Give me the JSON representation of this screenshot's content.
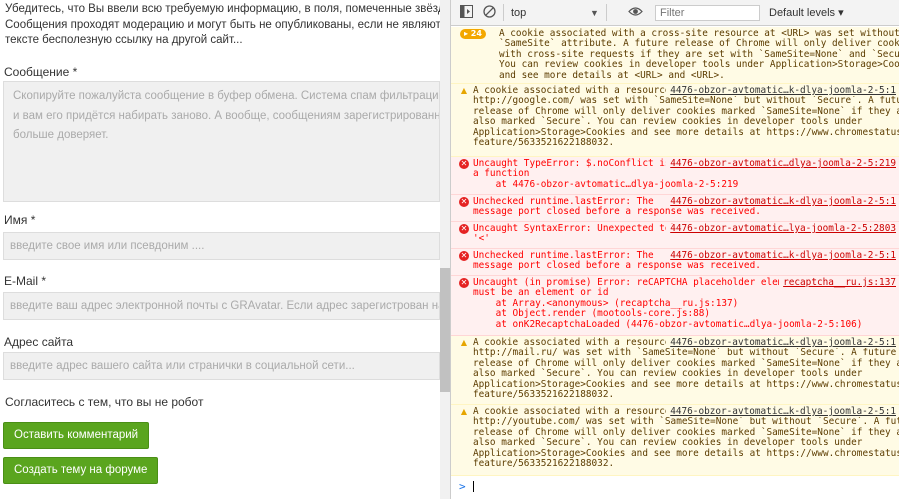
{
  "page": {
    "intro_lines": [
      "Убедитесь, что Вы ввели всю требуемую информацию, в поля, помеченные звёздочкой",
      "Сообщения проходят модерацию и могут быть не опубликованы, если не являются осмы",
      "тексте бесполезную ссылку на другой сайт..."
    ],
    "message_label": "Сообщение *",
    "message_placeholder_lines": [
      "Скопируйте пожалуйста сообщение в буфер обмена. Система спам фильтрации может з",
      "и вам его придётся набирать заново. А вообще, сообщениям зарегистрированных польз",
      "больше доверяет."
    ],
    "name_label": "Имя *",
    "name_placeholder": "введите свое имя или псевдоним ....",
    "email_label": "E-Mail *",
    "email_placeholder": "введите ваш адрес электронной почты с GRAvatar. Если адрес зарегистрован на сайте - в",
    "site_label": "Адрес сайта",
    "site_placeholder": "введите адрес вашего сайта или странички в социальной сети...",
    "captcha_text": "Согласитесь с тем, что вы не робот",
    "submit_button": "Оставить комментарий",
    "forum_button": "Создать тему на форуме"
  },
  "devtools": {
    "context": "top",
    "filter_placeholder": "Filter",
    "levels": "Default levels ▾",
    "badge_count": "24",
    "prompt": ">",
    "messages": [
      {
        "kind": "warn",
        "lines": [
          "A cookie associated with a cross-site resource at <URL> was set without the",
          "`SameSite` attribute. A future release of Chrome will only deliver cookies",
          "with cross-site requests if they are set with `SameSite=None` and `Secure`.",
          "You can review cookies in developer tools under Application>Storage>Cookies",
          "and see more details at <URL> and <URL>."
        ]
      },
      {
        "kind": "warn",
        "source": "4476-obzor-avtomatic…k-dlya-joomla-2-5:1",
        "lines": [
          "A cookie associated with a resource at",
          "http://google.com/ was set with `SameSite=None` but without `Secure`. A future",
          "release of Chrome will only deliver cookies marked `SameSite=None` if they are",
          "also marked `Secure`. You can review cookies in developer tools under",
          "Application>Storage>Cookies and see more details at https://www.chromestatus.com/",
          "feature/5633521622188032."
        ]
      },
      {
        "kind": "err",
        "source": "4476-obzor-avtomatic…dlya-joomla-2-5:219",
        "lines": [
          "Uncaught TypeError: $.noConflict is not",
          "a function",
          "    at 4476-obzor-avtomatic…dlya-joomla-2-5:219"
        ]
      },
      {
        "kind": "err",
        "source": "4476-obzor-avtomatic…k-dlya-joomla-2-5:1",
        "lines": [
          "Unchecked runtime.lastError: The",
          "message port closed before a response was received."
        ]
      },
      {
        "kind": "err",
        "source": "4476-obzor-avtomatic…lya-joomla-2-5:2803",
        "lines": [
          "Uncaught SyntaxError: Unexpected token",
          "'<'"
        ]
      },
      {
        "kind": "err",
        "source": "4476-obzor-avtomatic…k-dlya-joomla-2-5:1",
        "lines": [
          "Unchecked runtime.lastError: The",
          "message port closed before a response was received."
        ]
      },
      {
        "kind": "err",
        "source": "recaptcha__ru.js:137",
        "lines": [
          "Uncaught (in promise) Error: reCAPTCHA placeholder element",
          "must be an element or id",
          "    at Array.<anonymous> (recaptcha__ru.js:137)",
          "    at Object.render (mootools-core.js:88)",
          "    at onK2RecaptchaLoaded (4476-obzor-avtomatic…dlya-joomla-2-5:106)"
        ]
      },
      {
        "kind": "warn",
        "source": "4476-obzor-avtomatic…k-dlya-joomla-2-5:1",
        "lines": [
          "A cookie associated with a resource at",
          "http://mail.ru/ was set with `SameSite=None` but without `Secure`. A future",
          "release of Chrome will only deliver cookies marked `SameSite=None` if they are",
          "also marked `Secure`. You can review cookies in developer tools under",
          "Application>Storage>Cookies and see more details at https://www.chromestatus.com/",
          "feature/5633521622188032."
        ]
      },
      {
        "kind": "warn",
        "source": "4476-obzor-avtomatic…k-dlya-joomla-2-5:1",
        "lines": [
          "A cookie associated with a resource at",
          "http://youtube.com/ was set with `SameSite=None` but without `Secure`. A future",
          "release of Chrome will only deliver cookies marked `SameSite=None` if they are",
          "also marked `Secure`. You can review cookies in developer tools under",
          "Application>Storage>Cookies and see more details at https://www.chromestatus.com/",
          "feature/5633521622188032."
        ]
      }
    ]
  }
}
